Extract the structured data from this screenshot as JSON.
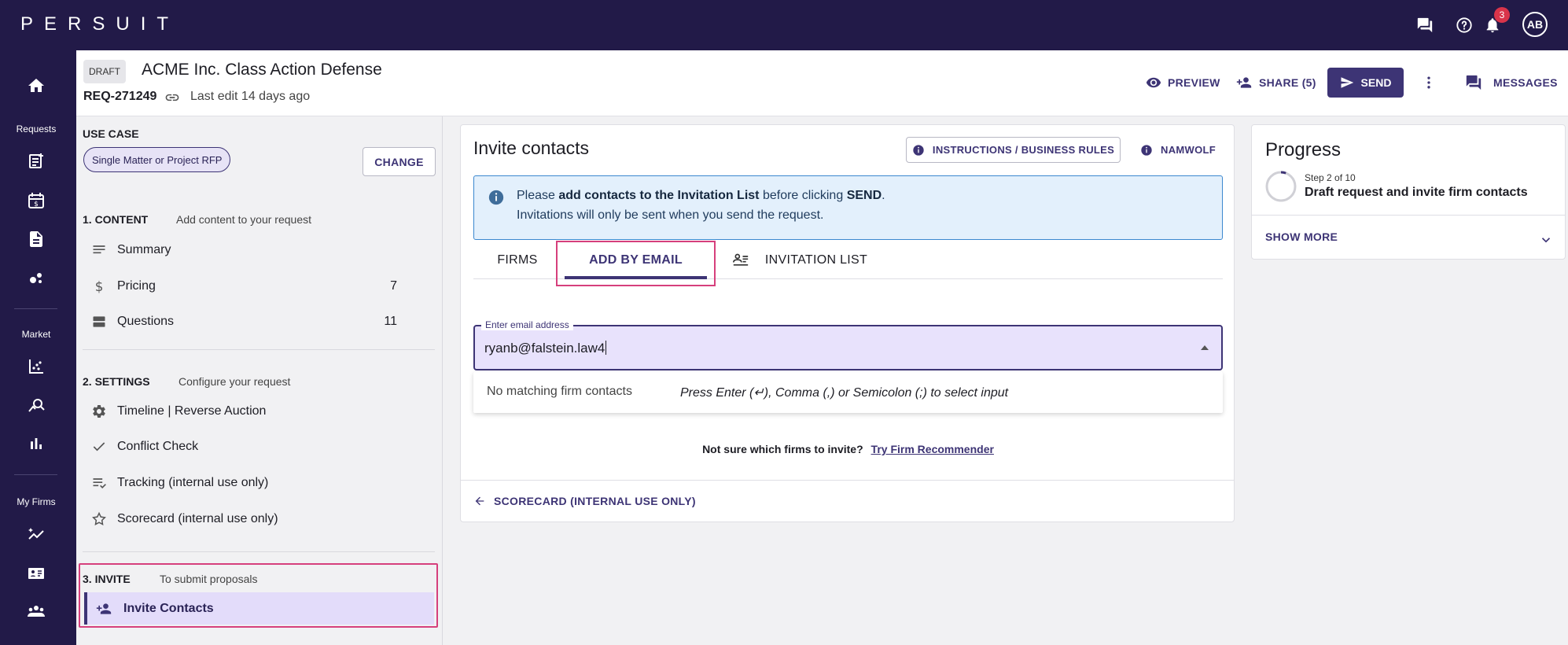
{
  "app": {
    "logo_text": "PERSUIT",
    "notifications_count": "3",
    "avatar_initials": "AB"
  },
  "rail": {
    "section_requests": "Requests",
    "section_market": "Market",
    "section_my_firms": "My Firms"
  },
  "header": {
    "status_badge": "DRAFT",
    "title": "ACME Inc. Class Action Defense",
    "request_id": "REQ-271249",
    "last_edit": "Last edit 14 days ago",
    "preview_label": "PREVIEW",
    "share_label": "SHARE (5)",
    "send_label": "SEND",
    "messages_label": "MESSAGES"
  },
  "left_panel": {
    "use_case_heading": "USE CASE",
    "use_case_value": "Single Matter or Project RFP",
    "change_label": "CHANGE",
    "content": {
      "heading": "1. CONTENT",
      "subtitle": "Add content to your request",
      "items": [
        {
          "label": "Summary",
          "count": ""
        },
        {
          "label": "Pricing",
          "count": "7"
        },
        {
          "label": "Questions",
          "count": "11"
        }
      ]
    },
    "settings": {
      "heading": "2. SETTINGS",
      "subtitle": "Configure your request",
      "items": [
        {
          "label": "Timeline | Reverse Auction"
        },
        {
          "label": "Conflict Check"
        },
        {
          "label": "Tracking (internal use only)"
        },
        {
          "label": "Scorecard (internal use only)"
        }
      ]
    },
    "invite": {
      "heading": "3. INVITE",
      "subtitle": "To submit proposals",
      "active_item": "Invite Contacts"
    }
  },
  "invite_card": {
    "title": "Invite contacts",
    "instructions_label": "INSTRUCTIONS / BUSINESS RULES",
    "namwolf_label": "NAMWOLF",
    "alert": {
      "prefix": "Please",
      "bold1": "add contacts to the Invitation List",
      "middle": "before clicking",
      "bold2": "SEND",
      "suffix": ".",
      "line2": "Invitations will only be sent when you send the request."
    },
    "tabs": [
      {
        "label": "FIRMS"
      },
      {
        "label": "ADD BY EMAIL"
      },
      {
        "label": "INVITATION LIST"
      }
    ],
    "active_tab": "ADD BY EMAIL",
    "email_field": {
      "label": "Enter email address",
      "value": "ryanb@falstein.law4"
    },
    "dropdown": {
      "no_match": "No matching firm contacts",
      "hint": "Press Enter (↵), Comma (,) or Semicolon (;) to select input"
    },
    "recommender_question": "Not sure which firms to invite?",
    "recommender_link": "Try Firm Recommender",
    "back_link": "SCORECARD (INTERNAL USE ONLY)"
  },
  "progress": {
    "title": "Progress",
    "step": "Step 2 of 10",
    "description": "Draft request and invite firm contacts",
    "show_more": "SHOW MORE"
  },
  "colors": {
    "brand_dark": "#221a48",
    "accent": "#3d3475",
    "highlight_pink": "#d63f7c",
    "info_blue": "#3c88cf"
  }
}
